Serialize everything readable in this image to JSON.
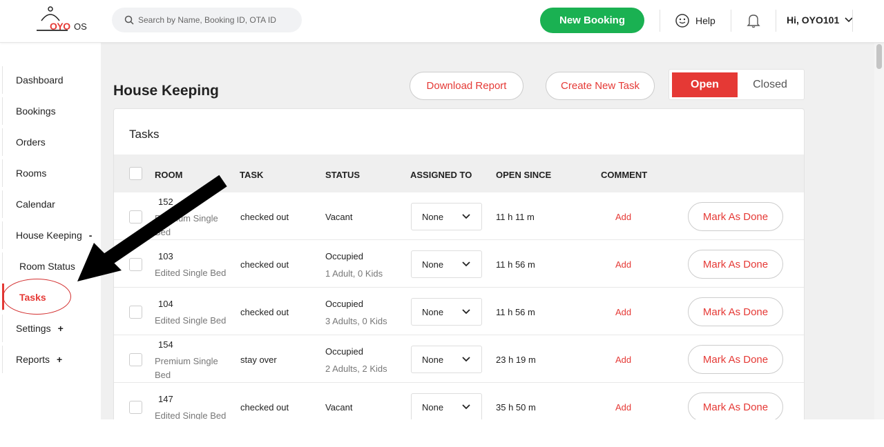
{
  "header": {
    "logo_text": "OYO",
    "logo_suffix": "OS",
    "search_placeholder": "Search by Name, Booking ID, OTA ID",
    "new_booking_label": "New Booking",
    "help_label": "Help",
    "user_label": "Hi, OYO101"
  },
  "sidebar": {
    "items": [
      {
        "label": "Dashboard"
      },
      {
        "label": "Bookings"
      },
      {
        "label": "Orders"
      },
      {
        "label": "Rooms"
      },
      {
        "label": "Calendar"
      },
      {
        "label": "House Keeping",
        "sign": "-"
      },
      {
        "label": "Room Status"
      },
      {
        "label": "Tasks"
      },
      {
        "label": "Settings",
        "sign": "+"
      },
      {
        "label": "Reports",
        "sign": "+"
      }
    ]
  },
  "main": {
    "title": "House Keeping",
    "download_label": "Download Report",
    "create_label": "Create New Task",
    "toggle": {
      "open": "Open",
      "closed": "Closed"
    },
    "card_title": "Tasks",
    "columns": [
      "ROOM",
      "TASK",
      "STATUS",
      "ASSIGNED TO",
      "OPEN SINCE",
      "COMMENT"
    ],
    "rows": [
      {
        "room": "152",
        "type": "Premium Single Bed",
        "task": "checked out",
        "status": "Vacant",
        "guests": "",
        "assigned": "None",
        "open_since": "11 h 11 m",
        "comment": "Add",
        "action": "Mark As Done"
      },
      {
        "room": "103",
        "type": "Edited Single Bed",
        "task": "checked out",
        "status": "Occupied",
        "guests": "1 Adult, 0 Kids",
        "assigned": "None",
        "open_since": "11 h 56 m",
        "comment": "Add",
        "action": "Mark As Done"
      },
      {
        "room": "104",
        "type": "Edited Single Bed",
        "task": "checked out",
        "status": "Occupied",
        "guests": "3 Adults, 0 Kids",
        "assigned": "None",
        "open_since": "11 h 56 m",
        "comment": "Add",
        "action": "Mark As Done"
      },
      {
        "room": "154",
        "type": "Premium Single Bed",
        "task": "stay over",
        "status": "Occupied",
        "guests": "2 Adults, 2 Kids",
        "assigned": "None",
        "open_since": "23 h 19 m",
        "comment": "Add",
        "action": "Mark As Done"
      },
      {
        "room": "147",
        "type": "Edited Single Bed",
        "task": "checked out",
        "status": "Vacant",
        "guests": "",
        "assigned": "None",
        "open_since": "35 h 50 m",
        "comment": "Add",
        "action": "Mark As Done"
      }
    ]
  },
  "colors": {
    "brand_red": "#e53935",
    "green": "#1ab152",
    "annotation_arrow": "#000000",
    "annotation_circle": "#d32f2f"
  }
}
